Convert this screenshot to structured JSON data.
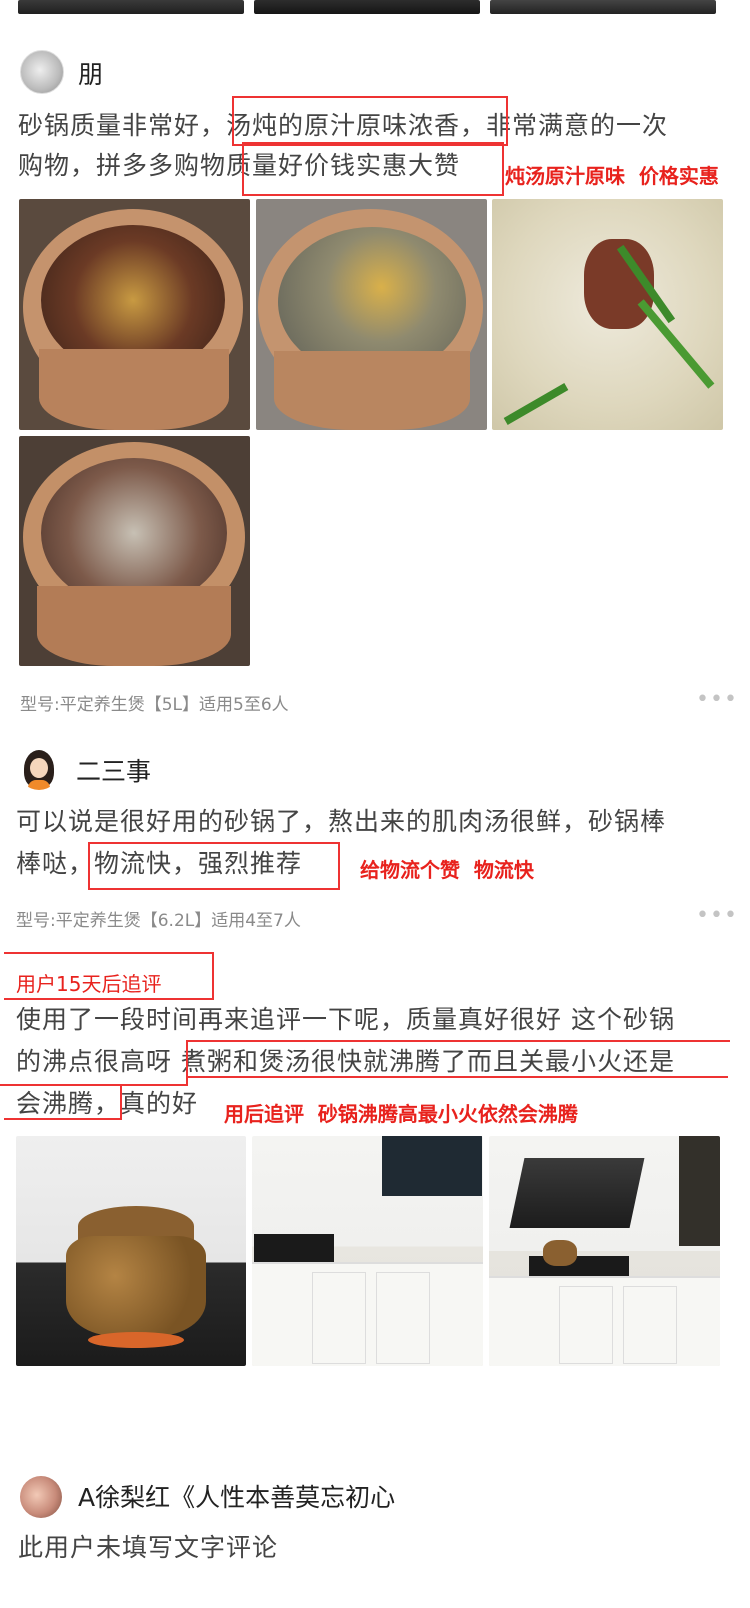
{
  "reviews": [
    {
      "username": "朋",
      "text_lines": [
        "砂锅质量非常好，汤炖的原汁原味浓香，非常满意的一次",
        "购物，拼多多购物质量好价钱实惠大赞"
      ],
      "annotation": "炖汤原汁原味  价格实惠",
      "spec": "型号:平定养生煲【5L】适用5至6人",
      "more": "•••"
    },
    {
      "username": "二三事",
      "text_lines": [
        "可以说是很好用的砂锅了，熬出来的肌肉汤很鲜，砂锅棒",
        "棒哒，物流快，强烈推荐"
      ],
      "annotation": "给物流个赞  物流快",
      "spec": "型号:平定养生煲【6.2L】适用4至7人",
      "more": "•••"
    }
  ],
  "followup": {
    "label": "用户15天后追评",
    "text_lines": [
      "使用了一段时间再来追评一下呢，质量真好很好 这个砂锅",
      "的沸点很高呀 煮粥和煲汤很快就沸腾了而且关最小火还是",
      "会沸腾，真的好"
    ],
    "annotation": "用后追评  砂锅沸腾高最小火依然会沸腾"
  },
  "third_review": {
    "username": "A徐梨红《人性本善莫忘初心",
    "text": "此用户未填写文字评论"
  },
  "colors": {
    "accent_red": "#e8221d",
    "meta_gray": "#8a8a8a"
  }
}
